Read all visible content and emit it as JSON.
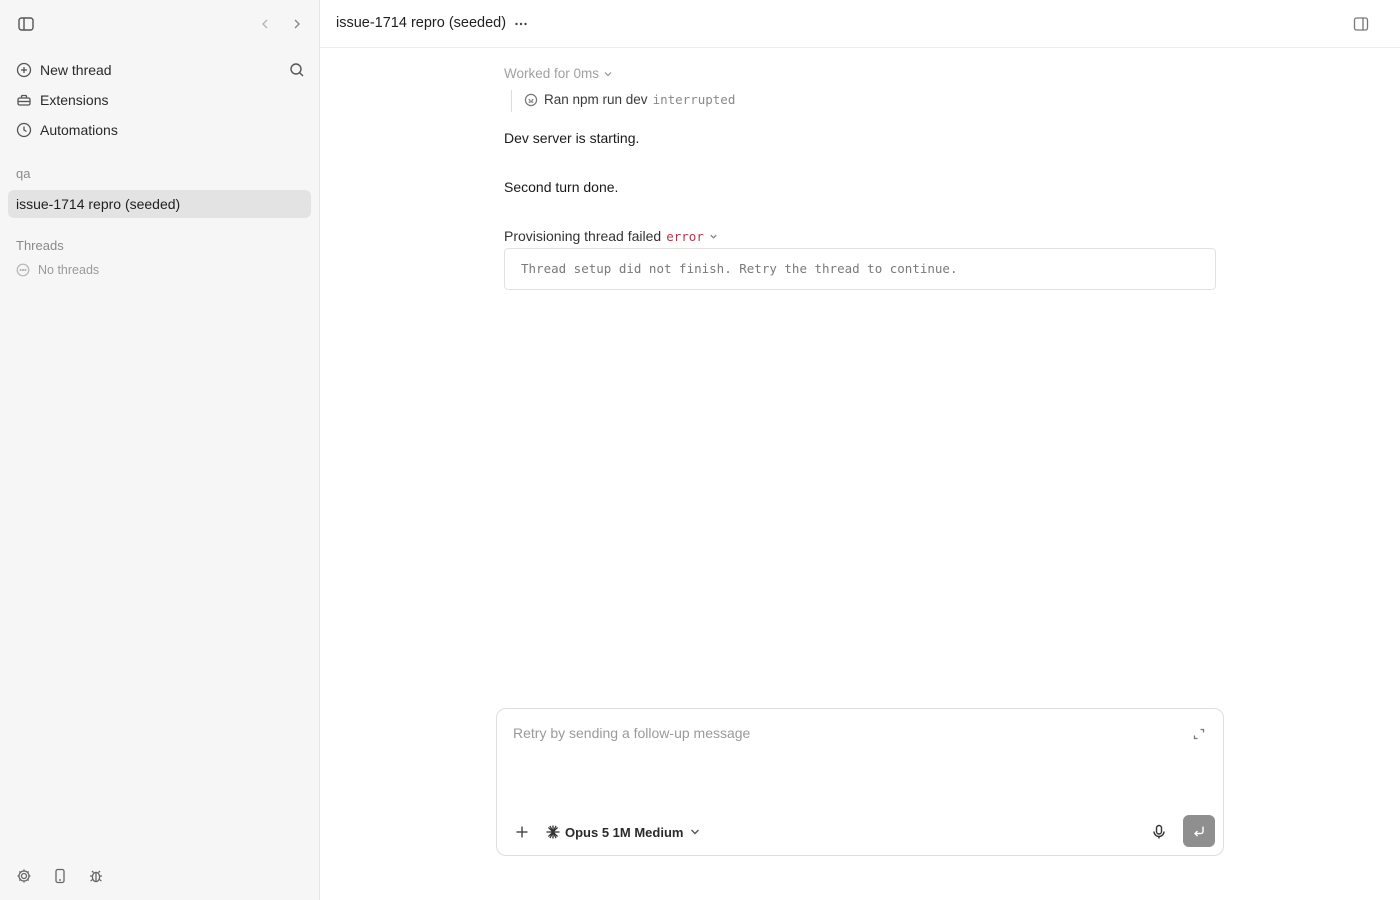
{
  "sidebar": {
    "nav": {
      "new_thread": "New thread",
      "extensions": "Extensions",
      "automations": "Automations"
    },
    "project_label": "qa",
    "active_thread": "issue-1714 repro (seeded)",
    "threads_label": "Threads",
    "threads_empty": "No threads",
    "bottom_icons": [
      "gear-icon",
      "phone-icon",
      "bug-icon"
    ]
  },
  "header": {
    "title": "issue-1714 repro (seeded)",
    "more_label": "···"
  },
  "conversation": {
    "worked_for": "Worked for 0ms",
    "tool_call": {
      "command": "Ran npm run dev",
      "status": "interrupted"
    },
    "messages": [
      "Dev server is starting.",
      "Second turn done."
    ],
    "error": {
      "title": "Provisioning thread failed",
      "tag": "error",
      "detail": "Thread setup did not finish. Retry the thread to continue."
    }
  },
  "composer": {
    "placeholder": "Retry by sending a follow-up message",
    "value": "",
    "model": "Opus 5 1M Medium"
  },
  "colors": {
    "sidebar_bg": "#f6f6f6",
    "active_item_bg": "#e3e3e3",
    "error_tag": "#b8344a",
    "send_button": "#8f8f8f"
  }
}
